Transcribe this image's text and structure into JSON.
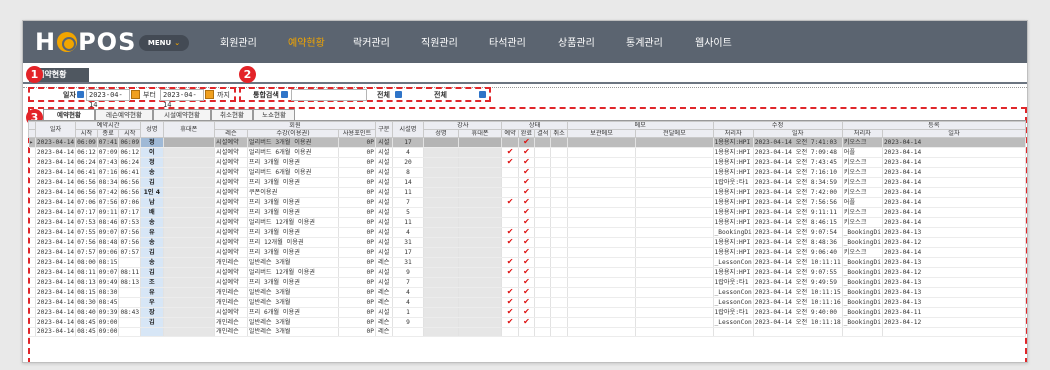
{
  "app": {
    "logo": "HOPOS",
    "menu_label": "MENU",
    "nav": [
      "회원관리",
      "예약현황",
      "락커관리",
      "직원관리",
      "타석관리",
      "상품관리",
      "통계관리",
      "웹사이트"
    ],
    "active_nav": "예약현황",
    "page_tab": "예약현황"
  },
  "badges": [
    "1",
    "2",
    "3"
  ],
  "filters": {
    "date_label": "일자",
    "date_from": "2023-04-14",
    "from_word": "부터",
    "date_to": "2023-04-14",
    "to_word": "까지",
    "search_label": "통합검색",
    "search_value": "",
    "filter1_label": "전체",
    "filter2_label": "전체"
  },
  "subtabs": [
    "예약현황",
    "레슨예약현황",
    "시설예약현황",
    "취소현황",
    "노쇼현황"
  ],
  "columns": {
    "group": [
      "예약시간",
      "회원",
      "강사",
      "상태",
      "메모",
      "수정",
      "등록"
    ],
    "date": "일자",
    "start": "시작",
    "end": "종료",
    "start2": "시작",
    "name": "성명",
    "phone": "휴대폰",
    "lesson": "레슨",
    "course": "수강(이용권)",
    "points": "사용포인트",
    "type": "구분",
    "fac": "시설명",
    "t_name": "성명",
    "t_phone": "휴대폰",
    "s_res": "예약",
    "s_done": "완료",
    "s_abs": "결석",
    "s_cancel": "취소",
    "m_keep": "보관메모",
    "m_inq": "전달메모",
    "mod_by": "처리자",
    "mod_date": "일자",
    "reg_by": "처리자",
    "reg_date": "일자"
  },
  "rows": [
    {
      "date": "2023-04-14",
      "start": "06:09",
      "end": "07:41",
      "start2": "06:09",
      "name": "정",
      "lesson": "시설예약",
      "course": "얼리버드 3개월 이용권",
      "points": "0P",
      "type": "시설",
      "fac": "17",
      "chk": [
        false,
        true
      ],
      "mod_by": "1용용지:HPI",
      "mod_date": "2023-04-14 오전 7:41:03",
      "reg_by": "키오스크",
      "reg_date": "2023-04-14",
      "sel": true
    },
    {
      "date": "2023-04-14",
      "start": "06:12",
      "end": "07:09",
      "start2": "06:12",
      "name": "이",
      "lesson": "시설예약",
      "course": "얼리버드 6개월 이용권",
      "points": "0P",
      "type": "시설",
      "fac": "4",
      "chk": [
        true,
        true
      ],
      "mod_by": "1용용지:HPI",
      "mod_date": "2023-04-14 오전 7:09:48",
      "reg_by": "어플",
      "reg_date": "2023-04-14"
    },
    {
      "date": "2023-04-14",
      "start": "06:24",
      "end": "07:43",
      "start2": "06:24",
      "name": "정",
      "lesson": "시설예약",
      "course": "프리 3개월 이용권",
      "points": "0P",
      "type": "시설",
      "fac": "20",
      "chk": [
        true,
        true
      ],
      "mod_by": "1용용지:HPI",
      "mod_date": "2023-04-14 오전 7:43:45",
      "reg_by": "키오스크",
      "reg_date": "2023-04-14"
    },
    {
      "date": "2023-04-14",
      "start": "06:41",
      "end": "07:16",
      "start2": "06:41",
      "name": "송",
      "lesson": "시설예약",
      "course": "얼리버드 6개월 이용권",
      "points": "0P",
      "type": "시설",
      "fac": "8",
      "chk": [
        false,
        true
      ],
      "mod_by": "1용용지:HPI",
      "mod_date": "2023-04-14 오전 7:16:10",
      "reg_by": "키오스크",
      "reg_date": "2023-04-14"
    },
    {
      "date": "2023-04-14",
      "start": "06:56",
      "end": "08:34",
      "start2": "06:56",
      "name": "김",
      "lesson": "시설예약",
      "course": "프리 3개월 이용권",
      "points": "0P",
      "type": "시설",
      "fac": "14",
      "chk": [
        false,
        true
      ],
      "mod_by": "1랍아웃:타1",
      "mod_date": "2023-04-14 오전 8:34:59",
      "reg_by": "키오스크",
      "reg_date": "2023-04-14"
    },
    {
      "date": "2023-04-14",
      "start": "06:56",
      "end": "07:42",
      "start2": "06:56",
      "name": "1인 4",
      "lesson": "시설예약",
      "course": "쿠폰이용권",
      "points": "0P",
      "type": "시설",
      "fac": "11",
      "chk": [
        false,
        true
      ],
      "mod_by": "1용용지:HPI",
      "mod_date": "2023-04-14 오전 7:42:00",
      "reg_by": "키오스크",
      "reg_date": "2023-04-14"
    },
    {
      "date": "2023-04-14",
      "start": "07:06",
      "end": "07:56",
      "start2": "07:06",
      "name": "남",
      "lesson": "시설예약",
      "course": "프리 3개월 이용권",
      "points": "0P",
      "type": "시설",
      "fac": "7",
      "chk": [
        true,
        true
      ],
      "mod_by": "1용용지:HPI",
      "mod_date": "2023-04-14 오전 7:56:56",
      "reg_by": "어플",
      "reg_date": "2023-04-14"
    },
    {
      "date": "2023-04-14",
      "start": "07:17",
      "end": "09:11",
      "start2": "07:17",
      "name": "배",
      "lesson": "시설예약",
      "course": "프리 3개월 이용권",
      "points": "0P",
      "type": "시설",
      "fac": "5",
      "chk": [
        false,
        true
      ],
      "mod_by": "1용용지:HPI",
      "mod_date": "2023-04-14 오전 9:11:11",
      "reg_by": "키오스크",
      "reg_date": "2023-04-14"
    },
    {
      "date": "2023-04-14",
      "start": "07:53",
      "end": "08:46",
      "start2": "07:53",
      "name": "송",
      "lesson": "시설예약",
      "course": "얼리버드 12개월 이용권",
      "points": "0P",
      "type": "시설",
      "fac": "11",
      "chk": [
        false,
        true
      ],
      "mod_by": "1용용지:HPI",
      "mod_date": "2023-04-14 오전 8:46:15",
      "reg_by": "키오스크",
      "reg_date": "2023-04-14"
    },
    {
      "date": "2023-04-14",
      "start": "07:55",
      "end": "09:07",
      "start2": "07:56",
      "name": "유",
      "lesson": "시설예약",
      "course": "프리 3개월 이용권",
      "points": "0P",
      "type": "시설",
      "fac": "4",
      "chk": [
        true,
        true
      ],
      "mod_by": "_BookingDi",
      "mod_date": "2023-04-14 오전 9:07:54",
      "reg_by": "_BookingDi",
      "reg_date": "2023-04-13"
    },
    {
      "date": "2023-04-14",
      "start": "07:56",
      "end": "08:48",
      "start2": "07:56",
      "name": "송",
      "lesson": "시설예약",
      "course": "프리 12개월 이용권",
      "points": "0P",
      "type": "시설",
      "fac": "31",
      "chk": [
        true,
        true
      ],
      "mod_by": "1용용지:HPI",
      "mod_date": "2023-04-14 오전 8:48:36",
      "reg_by": "_BookingDi",
      "reg_date": "2023-04-12"
    },
    {
      "date": "2023-04-14",
      "start": "07:57",
      "end": "09:06",
      "start2": "07:57",
      "name": "김",
      "lesson": "시설예약",
      "course": "프리 3개월 이용권",
      "points": "0P",
      "type": "시설",
      "fac": "17",
      "chk": [
        false,
        true
      ],
      "mod_by": "1용용지:HPI",
      "mod_date": "2023-04-14 오전 9:06:40",
      "reg_by": "키오스크",
      "reg_date": "2023-04-14"
    },
    {
      "date": "2023-04-14",
      "start": "08:00",
      "end": "08:15",
      "start2": "",
      "name": "송",
      "lesson": "개인레슨",
      "course": "일반레슨 3개월",
      "points": "0P",
      "type": "레슨",
      "fac": "31",
      "chk": [
        true,
        true
      ],
      "mod_by": "_LessonCon",
      "mod_date": "2023-04-14 오전 10:11:11",
      "reg_by": "_BookingDi",
      "reg_date": "2023-04-13"
    },
    {
      "date": "2023-04-14",
      "start": "08:11",
      "end": "09:07",
      "start2": "08:11",
      "name": "김",
      "lesson": "시설예약",
      "course": "얼리버드 12개월 이용권",
      "points": "0P",
      "type": "시설",
      "fac": "9",
      "chk": [
        true,
        true
      ],
      "mod_by": "1용용지:HPI",
      "mod_date": "2023-04-14 오전 9:07:55",
      "reg_by": "_BookingDi",
      "reg_date": "2023-04-12"
    },
    {
      "date": "2023-04-14",
      "start": "08:13",
      "end": "09:49",
      "start2": "08:13",
      "name": "조",
      "lesson": "시설예약",
      "course": "프리 3개월 이용권",
      "points": "0P",
      "type": "시설",
      "fac": "7",
      "chk": [
        false,
        true
      ],
      "mod_by": "1랍아웃:타1",
      "mod_date": "2023-04-14 오전 9:49:59",
      "reg_by": "_BookingDi",
      "reg_date": "2023-04-13"
    },
    {
      "date": "2023-04-14",
      "start": "08:15",
      "end": "08:30",
      "start2": "",
      "name": "유",
      "lesson": "개인레슨",
      "course": "일반레슨 3개월",
      "points": "0P",
      "type": "레슨",
      "fac": "4",
      "chk": [
        true,
        true
      ],
      "mod_by": "_LessonCon",
      "mod_date": "2023-04-14 오전 10:11:15",
      "reg_by": "_BookingDi",
      "reg_date": "2023-04-13"
    },
    {
      "date": "2023-04-14",
      "start": "08:30",
      "end": "08:45",
      "start2": "",
      "name": "우",
      "lesson": "개인레슨",
      "course": "일반레슨 3개월",
      "points": "0P",
      "type": "레슨",
      "fac": "4",
      "chk": [
        true,
        true
      ],
      "mod_by": "_LessonCon",
      "mod_date": "2023-04-14 오전 10:11:16",
      "reg_by": "_BookingDi",
      "reg_date": "2023-04-13"
    },
    {
      "date": "2023-04-14",
      "start": "08:40",
      "end": "09:39",
      "start2": "08:43",
      "name": "장",
      "lesson": "시설예약",
      "course": "프리 6개월 이용권",
      "points": "0P",
      "type": "시설",
      "fac": "1",
      "chk": [
        true,
        true
      ],
      "mod_by": "1랍아웃:타1",
      "mod_date": "2023-04-14 오전 9:40:00",
      "reg_by": "_BookingDi",
      "reg_date": "2023-04-11"
    },
    {
      "date": "2023-04-14",
      "start": "08:45",
      "end": "09:00",
      "start2": "",
      "name": "김",
      "lesson": "개인레슨",
      "course": "일반레슨 3개월",
      "points": "0P",
      "type": "레슨",
      "fac": "9",
      "chk": [
        true,
        true
      ],
      "mod_by": "_LessonCon",
      "mod_date": "2023-04-14 오전 10:11:18",
      "reg_by": "_BookingDi",
      "reg_date": "2023-04-12"
    },
    {
      "date": "2023-04-14",
      "start": "08:45",
      "end": "09:00",
      "start2": "",
      "name": "",
      "lesson": "개인레슨",
      "course": "일반레슨 3개월",
      "points": "0P",
      "type": "레슨",
      "fac": "",
      "chk": [
        false,
        false
      ],
      "mod_by": "",
      "mod_date": "",
      "reg_by": "",
      "reg_date": ""
    }
  ]
}
